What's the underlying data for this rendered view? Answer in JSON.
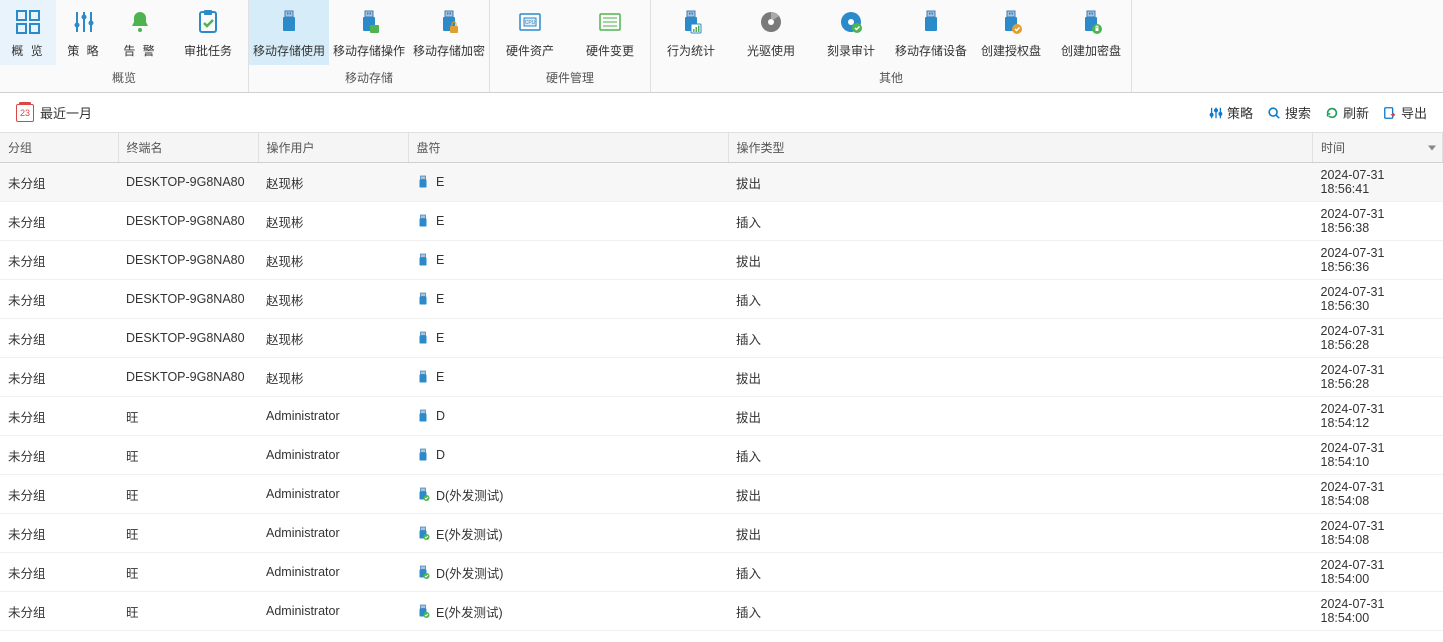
{
  "ribbon": {
    "groups": [
      {
        "label": "概览",
        "items": [
          {
            "label": "概 览",
            "icon": "overview"
          },
          {
            "label": "策 略",
            "icon": "strategy"
          },
          {
            "label": "告 警",
            "icon": "alert"
          },
          {
            "label": "审批任务",
            "icon": "approve",
            "wide": true
          }
        ]
      },
      {
        "label": "移动存储",
        "items": [
          {
            "label": "移动存储使用",
            "icon": "usb-use",
            "wide": true,
            "active": true
          },
          {
            "label": "移动存储操作",
            "icon": "usb-op",
            "wide": true
          },
          {
            "label": "移动存储加密",
            "icon": "usb-enc",
            "wide": true
          }
        ]
      },
      {
        "label": "硬件管理",
        "items": [
          {
            "label": "硬件资产",
            "icon": "hw-asset",
            "wide": true
          },
          {
            "label": "硬件变更",
            "icon": "hw-change",
            "wide": true
          }
        ]
      },
      {
        "label": "其他",
        "items": [
          {
            "label": "行为统计",
            "icon": "stats",
            "wide": true
          },
          {
            "label": "光驱使用",
            "icon": "cd",
            "wide": true
          },
          {
            "label": "刻录审计",
            "icon": "burn",
            "wide": true
          },
          {
            "label": "移动存储设备",
            "icon": "usb-dev",
            "wide": true
          },
          {
            "label": "创建授权盘",
            "icon": "auth-disk",
            "wide": true
          },
          {
            "label": "创建加密盘",
            "icon": "enc-disk",
            "wide": true
          }
        ]
      }
    ]
  },
  "toolbar": {
    "date_range": "最近一月",
    "date_day": "23",
    "actions": {
      "policy": "策略",
      "search": "搜索",
      "refresh": "刷新",
      "export": "导出"
    }
  },
  "table": {
    "headers": {
      "group": "分组",
      "terminal": "终端名",
      "user": "操作用户",
      "drive": "盘符",
      "op": "操作类型",
      "time": "时间"
    },
    "rows": [
      {
        "group": "未分组",
        "terminal": "DESKTOP-9G8NA80",
        "user": "赵现彬",
        "drive": "E",
        "icon": "usb",
        "op": "拔出",
        "time": "2024-07-31 18:56:41",
        "striped": true
      },
      {
        "group": "未分组",
        "terminal": "DESKTOP-9G8NA80",
        "user": "赵现彬",
        "drive": "E",
        "icon": "usb",
        "op": "插入",
        "time": "2024-07-31 18:56:38"
      },
      {
        "group": "未分组",
        "terminal": "DESKTOP-9G8NA80",
        "user": "赵现彬",
        "drive": "E",
        "icon": "usb",
        "op": "拔出",
        "time": "2024-07-31 18:56:36"
      },
      {
        "group": "未分组",
        "terminal": "DESKTOP-9G8NA80",
        "user": "赵现彬",
        "drive": "E",
        "icon": "usb",
        "op": "插入",
        "time": "2024-07-31 18:56:30"
      },
      {
        "group": "未分组",
        "terminal": "DESKTOP-9G8NA80",
        "user": "赵现彬",
        "drive": "E",
        "icon": "usb",
        "op": "插入",
        "time": "2024-07-31 18:56:28"
      },
      {
        "group": "未分组",
        "terminal": "DESKTOP-9G8NA80",
        "user": "赵现彬",
        "drive": "E",
        "icon": "usb",
        "op": "拔出",
        "time": "2024-07-31 18:56:28"
      },
      {
        "group": "未分组",
        "terminal": "旺",
        "user": "Administrator",
        "drive": "D",
        "icon": "usb",
        "op": "拔出",
        "time": "2024-07-31 18:54:12"
      },
      {
        "group": "未分组",
        "terminal": "旺",
        "user": "Administrator",
        "drive": "D",
        "icon": "usb",
        "op": "插入",
        "time": "2024-07-31 18:54:10"
      },
      {
        "group": "未分组",
        "terminal": "旺",
        "user": "Administrator",
        "drive": "D(外发测试)",
        "icon": "usb-auth",
        "op": "拔出",
        "time": "2024-07-31 18:54:08"
      },
      {
        "group": "未分组",
        "terminal": "旺",
        "user": "Administrator",
        "drive": "E(外发测试)",
        "icon": "usb-auth",
        "op": "拔出",
        "time": "2024-07-31 18:54:08"
      },
      {
        "group": "未分组",
        "terminal": "旺",
        "user": "Administrator",
        "drive": "D(外发测试)",
        "icon": "usb-auth",
        "op": "插入",
        "time": "2024-07-31 18:54:00"
      },
      {
        "group": "未分组",
        "terminal": "旺",
        "user": "Administrator",
        "drive": "E(外发测试)",
        "icon": "usb-auth",
        "op": "插入",
        "time": "2024-07-31 18:54:00"
      }
    ]
  }
}
